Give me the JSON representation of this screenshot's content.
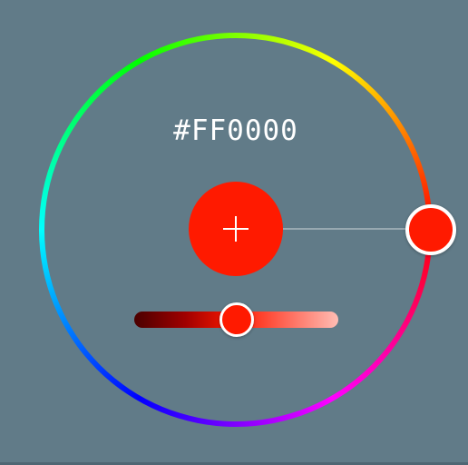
{
  "color_picker": {
    "hex_value": "#FF0000",
    "selected_color": "#FF0000",
    "add_button": {
      "icon": "plus-icon"
    },
    "hue_ring": {
      "hue_degrees": 0,
      "colors": [
        "#FF0000",
        "#FFFF00",
        "#00FF00",
        "#00FFFF",
        "#0000FF",
        "#FF00FF"
      ]
    },
    "lightness_slider": {
      "value_fraction": 0.5,
      "gradient_colors": [
        "#4A0000",
        "#FF1A00",
        "#FFBDB4"
      ]
    }
  },
  "background_color": "#617B88"
}
